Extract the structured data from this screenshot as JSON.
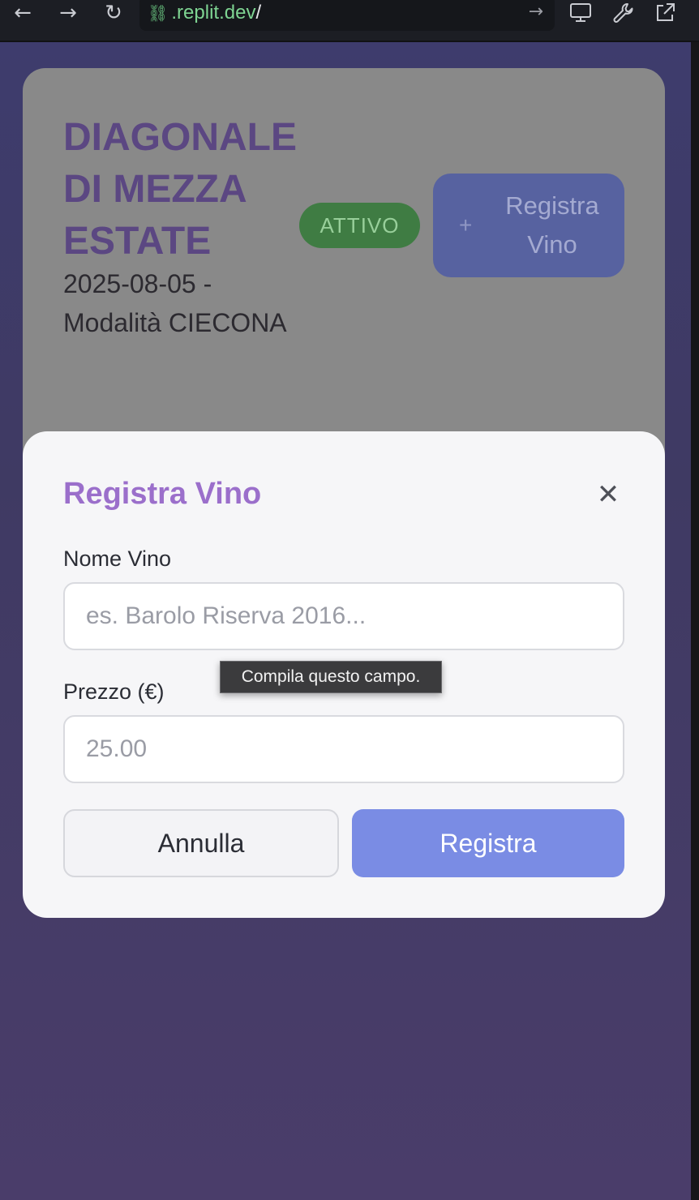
{
  "browser": {
    "url_host": ".replit.dev",
    "url_path": "/"
  },
  "event": {
    "title": "DIAGONALE DI MEZZA ESTATE",
    "subtitle": "2025-08-05 - Modalità CIECONA",
    "status": "ATTIVO",
    "register_button_label": "Registra Vino",
    "status_color": "#3f7c43",
    "accent_color": "#5b4782"
  },
  "modal": {
    "title": "Registra Vino",
    "name_label": "Nome Vino",
    "name_placeholder": "es. Barolo Riserva 2016...",
    "name_value": "",
    "validation_tooltip": "Compila questo campo.",
    "price_label": "Prezzo (€)",
    "price_placeholder": "25.00",
    "price_value": "",
    "cancel_label": "Annulla",
    "submit_label": "Registra",
    "title_color": "#9b6fcb",
    "submit_color": "#7a8ce4"
  },
  "icons": {
    "back": "arrow-left",
    "forward": "arrow-right",
    "reload": "reload",
    "link": "link",
    "go": "arrow-right",
    "devices": "monitor",
    "tools": "wrench",
    "external": "external-link",
    "close": "close",
    "plus": "plus"
  }
}
